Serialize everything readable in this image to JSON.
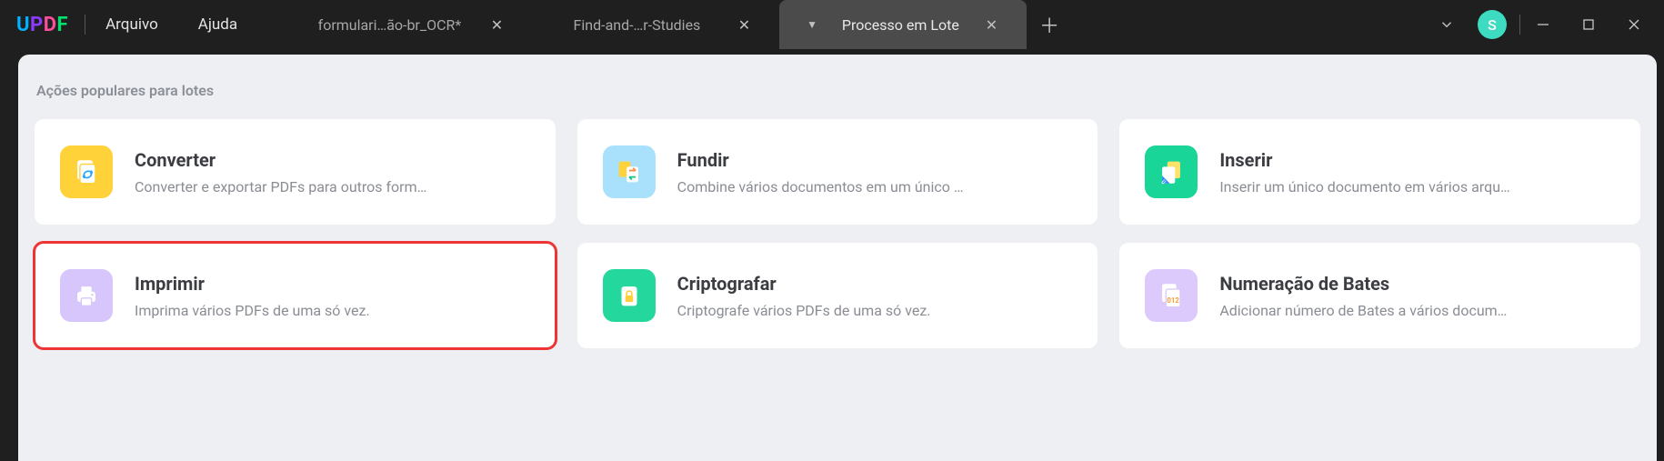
{
  "menus": {
    "file": "Arquivo",
    "help": "Ajuda"
  },
  "tabs": [
    {
      "label": "formulari…ão-br_OCR*",
      "active": false,
      "hasDropdown": false
    },
    {
      "label": "Find-and-…r-Studies",
      "active": false,
      "hasDropdown": false
    },
    {
      "label": "Processo em Lote",
      "active": true,
      "hasDropdown": true
    }
  ],
  "avatar": "S",
  "section_title": "Ações populares para lotes",
  "cards": [
    {
      "title": "Converter",
      "desc": "Converter e exportar PDFs para outros form…"
    },
    {
      "title": "Fundir",
      "desc": "Combine vários documentos em um único …"
    },
    {
      "title": "Inserir",
      "desc": "Inserir um único documento em vários arqu…"
    },
    {
      "title": "Imprimir",
      "desc": "Imprima vários PDFs de uma só vez."
    },
    {
      "title": "Criptografar",
      "desc": "Criptografe vários PDFs de uma só vez."
    },
    {
      "title": "Numeração de Bates",
      "desc": "Adicionar número de Bates a vários docum…"
    }
  ]
}
